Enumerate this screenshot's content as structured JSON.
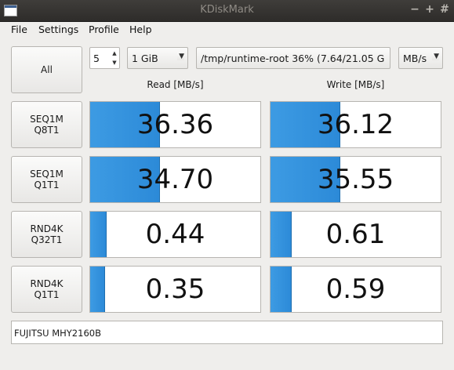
{
  "window": {
    "title": "KDiskMark"
  },
  "menu": [
    "File",
    "Settings",
    "Profile",
    "Help"
  ],
  "controls": {
    "all_label": "All",
    "loops": "5",
    "size": "1 GiB",
    "path": "/tmp/runtime-root 36% (7.64/21.05 G",
    "unit": "MB/s"
  },
  "headers": {
    "read": "Read [MB/s]",
    "write": "Write [MB/s]"
  },
  "tests": [
    {
      "label": "SEQ1M\nQ8T1",
      "read": "36.36",
      "read_fill": 0.4,
      "write": "36.12",
      "write_fill": 0.4
    },
    {
      "label": "SEQ1M\nQ1T1",
      "read": "34.70",
      "read_fill": 0.4,
      "write": "35.55",
      "write_fill": 0.4
    },
    {
      "label": "RND4K\nQ32T1",
      "read": "0.44",
      "read_fill": 0.09,
      "write": "0.61",
      "write_fill": 0.12
    },
    {
      "label": "RND4K\nQ1T1",
      "read": "0.35",
      "read_fill": 0.08,
      "write": "0.59",
      "write_fill": 0.12
    }
  ],
  "device": "FUJITSU MHY2160B"
}
